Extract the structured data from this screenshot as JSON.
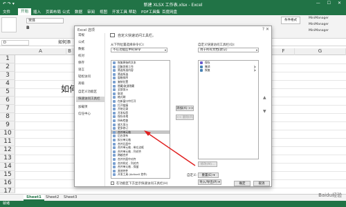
{
  "app": {
    "title": "新建 XLSX 工作表.xlsx - Excel",
    "qat": "↶ ↷ ▾",
    "window_buttons": "— ☐ ✕"
  },
  "ribbon": {
    "tabs": [
      "文件",
      "开始",
      "插入",
      "页面布局",
      "公式",
      "数据",
      "审阅",
      "视图",
      "开发工具",
      "帮助",
      "PDF工具集",
      "百度网盘"
    ],
    "font_name": "宋体",
    "bold": "B",
    "right_box": "条件格式",
    "mm_items": [
      "MiniManager",
      "MiniManager",
      "MiniManager"
    ]
  },
  "formula_bar": {
    "name_box": "D",
    "fx_value": "如何添"
  },
  "grid": {
    "columns": [
      "A",
      "B",
      "C",
      "D",
      "E",
      "F",
      "G"
    ],
    "rows": [
      "1",
      "2",
      "3",
      "4",
      "5",
      "6",
      "7",
      "8",
      "9",
      "10",
      "11",
      "12",
      "13",
      "14",
      "15",
      "16",
      "17"
    ],
    "cell_text": "如何"
  },
  "sheets": [
    "Sheet1",
    "Sheet2",
    "Sheet3"
  ],
  "status": "就绪",
  "dialog": {
    "title": "Excel 选项",
    "title_buttons": "?  ✕",
    "nav": [
      "常规",
      "公式",
      "数据",
      "校对",
      "保存",
      "语言",
      "轻松访问",
      "高级",
      "自定义功能区",
      "快速访问工具栏",
      "加载项",
      "信任中心"
    ],
    "description": "自定义快速访问工具栏。",
    "choose_label": "从下列位置选择命令(C):",
    "choose_value": "不在功能区中的命令",
    "customize_label": "自定义快速访问工具栏(Q):",
    "customize_value": "用于所有文档(默认)",
    "commands": [
      "恢复原始的文本",
      "回复其他工作",
      "筛选所选内容",
      "筛选所选",
      "窗格排序",
      "复制位置",
      "隐藏/取消隐藏",
      "全部显示",
      "取消",
      "格式刷",
      "在新窗口中打开",
      "打开链接",
      "开始记录",
      "开发标签",
      "保存本地",
      "所有检查",
      "放大显示",
      "更多修订",
      "合并单元格",
      "后台发布",
      "拆分单元格",
      "合并后居中",
      "合并单元格 - 带左边框",
      "合并单元格 - 列对齐",
      "跨越合并",
      "合并并居中对齐",
      "合并样式 - 列对齐",
      "合并单元格 - 保留",
      "其他控件",
      "开发工具 (ActiveX 控件)"
    ],
    "selected_index": 18,
    "qat_items": [
      "保存",
      "撤消",
      "恢复"
    ],
    "add_button": "添加(A) >>",
    "remove_button": "<< 删除(R)",
    "modify_button": "修改(M)...",
    "customize_label2": "自定义:",
    "reset_button": "重置(E) ▾",
    "import_export_button": "导入/导出(P) ▾",
    "show_below_label": "在功能区下方显示快速访问工具栏(H)",
    "ok_button": "确定",
    "cancel_button": "取消"
  },
  "colors": {
    "excel_green": "#217346",
    "arrow_red": "#e02020"
  },
  "watermark": "Baidu经验"
}
